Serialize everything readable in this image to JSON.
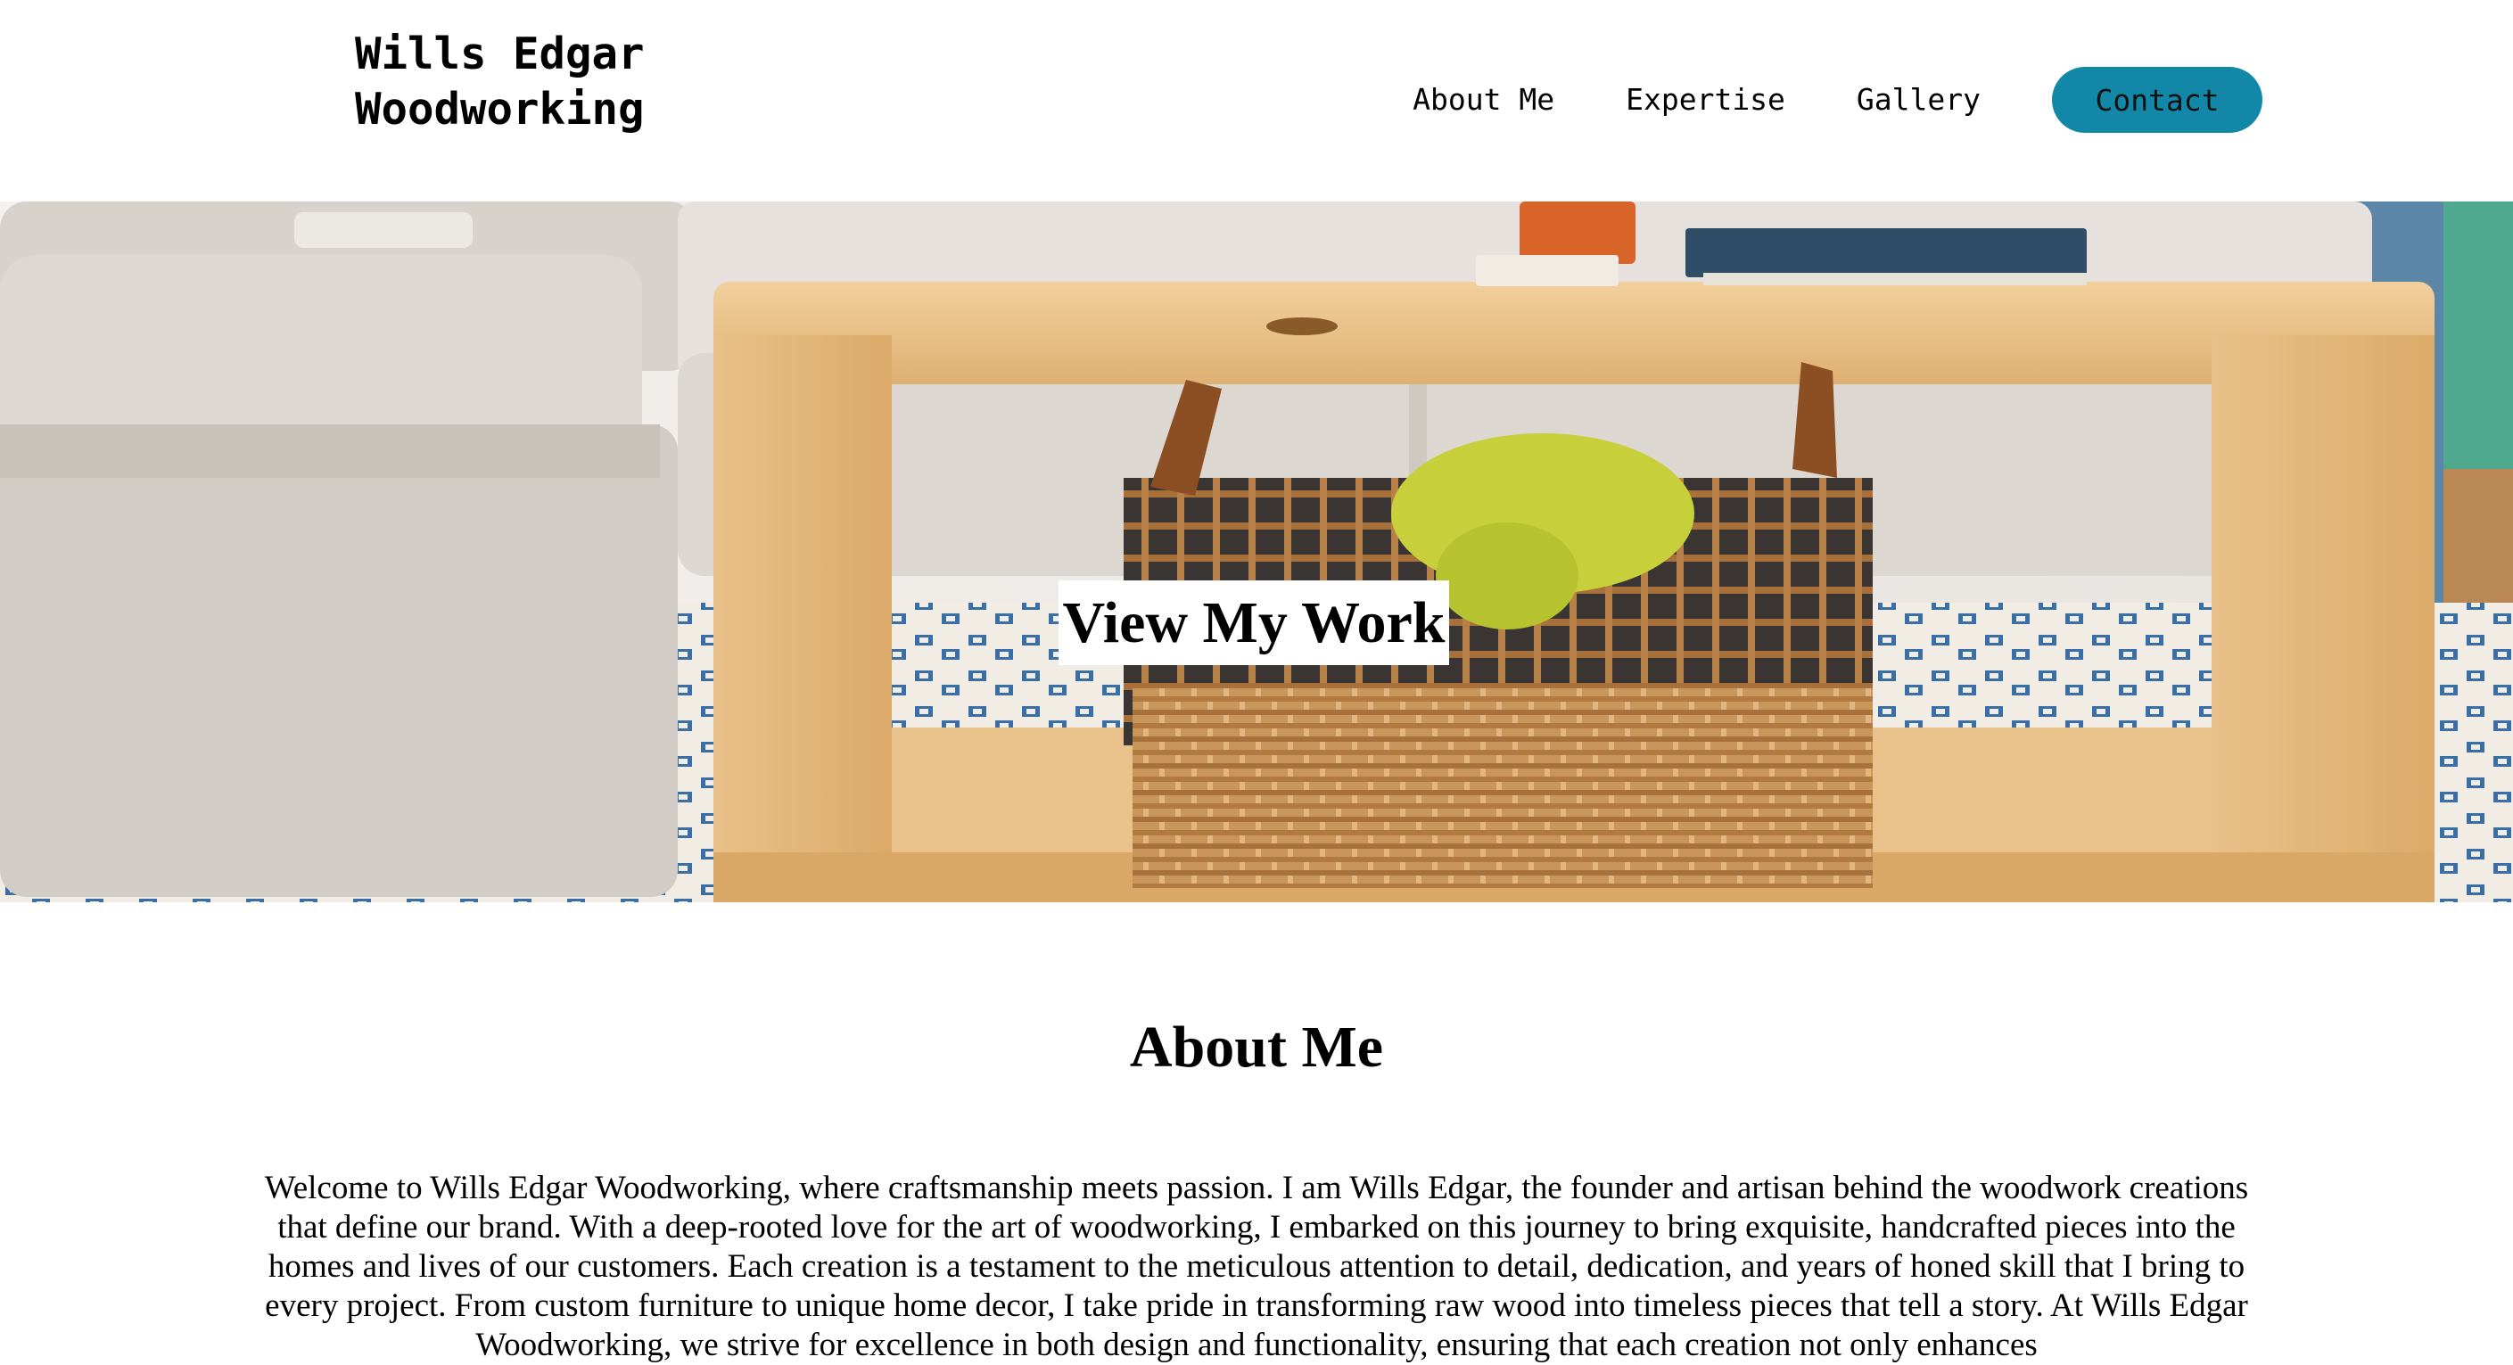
{
  "header": {
    "brand": "Wills Edgar\nWoodworking",
    "nav": {
      "about": "About Me",
      "expertise": "Expertise",
      "gallery": "Gallery",
      "contact": "Contact"
    }
  },
  "hero": {
    "cta_label": "View My Work",
    "image_description": "wooden-coffee-table-with-basket"
  },
  "about": {
    "heading": "About Me",
    "body": "Welcome to Wills Edgar Woodworking, where craftsmanship meets passion. I am Wills Edgar, the founder and artisan behind the woodwork creations that define our brand. With a deep-rooted love for the art of woodworking, I embarked on this journey to bring exquisite, handcrafted pieces into the homes and lives of our customers. Each creation is a testament to the meticulous attention to detail, dedication, and years of honed skill that I bring to every project. From custom furniture to unique home decor, I take pride in transforming raw wood into timeless pieces that tell a story. At Wills Edgar Woodworking, we strive for excellence in both design and functionality, ensuring that each creation not only enhances"
  },
  "colors": {
    "accent": "#1287a8",
    "wood": "#e3b679",
    "sofa": "#dcd6d1",
    "rug_blue": "#3a6fa5"
  }
}
